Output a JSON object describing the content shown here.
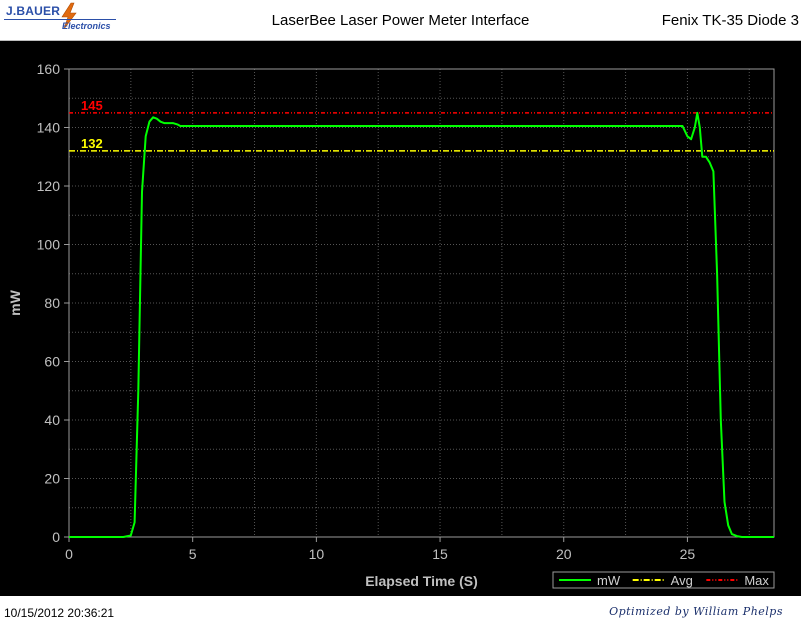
{
  "header": {
    "logo_top": "J.BAUER",
    "logo_bottom": "Electronics",
    "title": "LaserBee Laser Power Meter Interface",
    "subtitle": "Fenix TK-35 Diode 3"
  },
  "footer": {
    "timestamp": "10/15/2012 20:36:21",
    "credit": "Optimized by William Phelps"
  },
  "colors": {
    "background": "#000000",
    "grid": "#555555",
    "axis_text": "#c0c0c0",
    "series_mW": "#00ff00",
    "avg": "#ffff00",
    "max": "#ff0000"
  },
  "chart_data": {
    "type": "line",
    "xlabel": "Elapsed Time (S)",
    "ylabel": "mW",
    "xlim": [
      0,
      28.5
    ],
    "ylim": [
      0,
      160
    ],
    "xticks": [
      0,
      5,
      10,
      15,
      20,
      25
    ],
    "yticks": [
      0,
      20,
      40,
      60,
      80,
      100,
      120,
      140,
      160
    ],
    "grid": true,
    "legend_position": "bottom-right",
    "legend": [
      "mW",
      "Avg",
      "Max"
    ],
    "series": [
      {
        "name": "mW",
        "x": [
          0,
          2.2,
          2.5,
          2.65,
          2.8,
          2.95,
          3.1,
          3.25,
          3.4,
          3.55,
          3.7,
          3.85,
          4.0,
          4.2,
          4.4,
          4.5,
          10,
          20,
          24.8,
          25.0,
          25.15,
          25.3,
          25.4,
          25.5,
          25.6,
          25.75,
          25.9,
          26.05,
          26.2,
          26.35,
          26.5,
          26.65,
          26.8,
          27.0,
          27.2,
          28.5
        ],
        "y": [
          0,
          0,
          0.5,
          5,
          50,
          118,
          137,
          142,
          143.5,
          143,
          142,
          141.5,
          141.5,
          141.5,
          141,
          140.5,
          140.5,
          140.5,
          140.5,
          137,
          136,
          140,
          145,
          140,
          130,
          130,
          128,
          125,
          90,
          40,
          12,
          4,
          1,
          0.3,
          0,
          0
        ]
      },
      {
        "name": "Avg",
        "value": 132,
        "label": "132"
      },
      {
        "name": "Max",
        "value": 145,
        "label": "145"
      }
    ]
  }
}
